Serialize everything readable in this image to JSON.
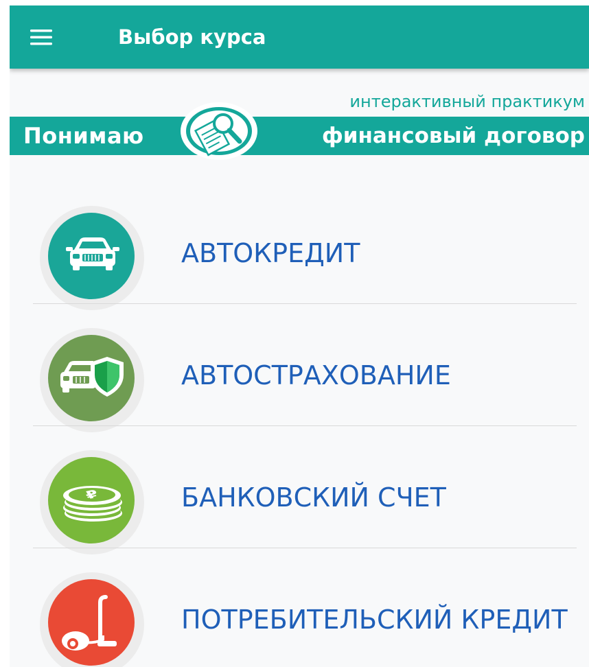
{
  "appbar": {
    "title": "Выбор курса",
    "color": "#14a79a",
    "menu_icon": "hamburger-menu-icon"
  },
  "banner": {
    "tagline": "интерактивный практикум",
    "word_left": "Понимаю",
    "word_right": "финансовый договор",
    "logo_icon": "magnifier-document-icon"
  },
  "courses": [
    {
      "label": "АВТОКРЕДИТ",
      "icon": "car-icon",
      "color": "#1aa698"
    },
    {
      "label": "АВТОСТРАХОВАНИЕ",
      "icon": "car-shield-icon",
      "color": "#6f9c52"
    },
    {
      "label": "БАНКОВСКИЙ СЧЕТ",
      "icon": "coin-stack-icon",
      "color": "#79b83a"
    },
    {
      "label": "ПОТРЕБИТЕЛЬСКИЙ КРЕДИТ",
      "icon": "vacuum-cleaner-icon",
      "color": "#e94a35"
    }
  ],
  "colors": {
    "link_text": "#1f5fb8",
    "background": "#f8f9fa"
  }
}
